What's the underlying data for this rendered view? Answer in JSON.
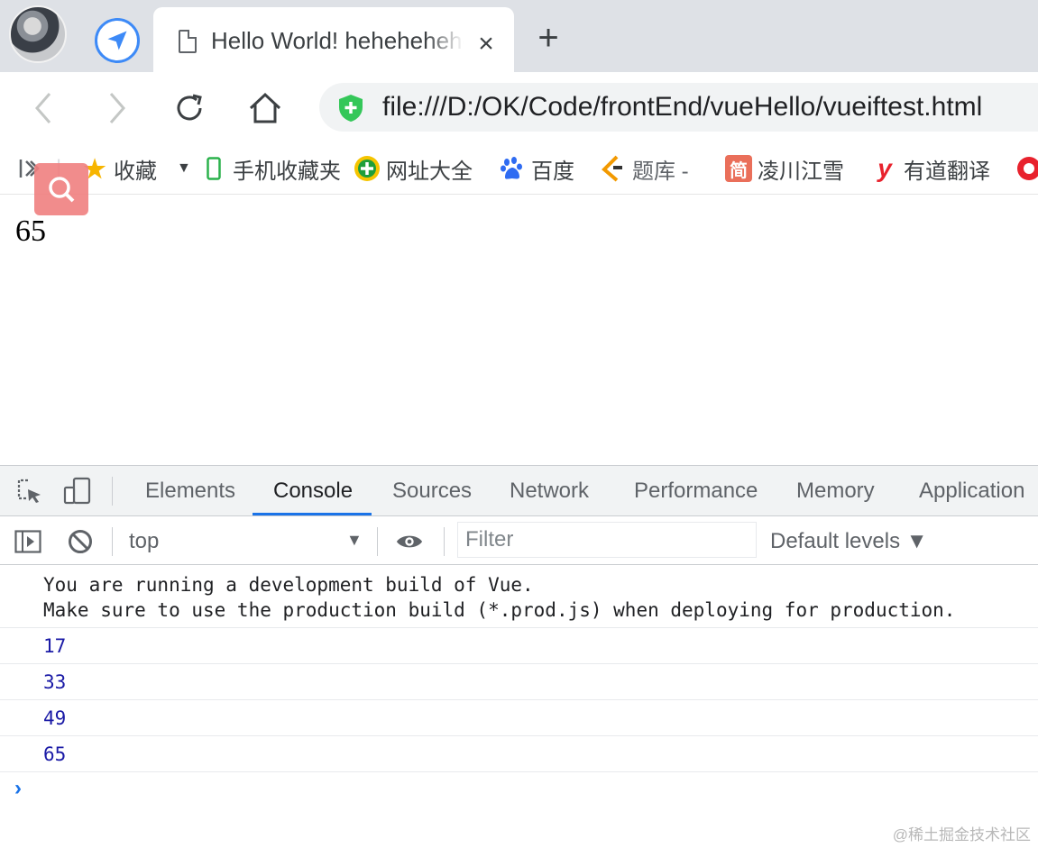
{
  "browser": {
    "tab": {
      "title": "Hello World! hehehehehe",
      "close_label": "×"
    },
    "new_tab_label": "+",
    "url": "file:///D:/OK/Code/frontEnd/vueHello/vueiftest.html",
    "bookmarks": [
      {
        "label": "收藏",
        "icon": "star-icon"
      },
      {
        "label": "手机收藏夹",
        "icon": "phone-icon"
      },
      {
        "label": "网址大全",
        "icon": "plus-circle-icon"
      },
      {
        "label": "百度",
        "icon": "baidu-paw-icon"
      },
      {
        "label": "题库 -",
        "icon": "tiku-icon"
      },
      {
        "label": "凌川江雪",
        "icon": "jian-icon"
      },
      {
        "label": "有道翻译",
        "icon": "youdao-y-icon"
      }
    ]
  },
  "page": {
    "value": "65"
  },
  "devtools": {
    "tabs": [
      "Elements",
      "Console",
      "Sources",
      "Network",
      "Performance",
      "Memory",
      "Application"
    ],
    "active_tab": "Console",
    "context": "top",
    "filter_placeholder": "Filter",
    "levels": "Default levels ▼",
    "messages": {
      "info_line1": "You are running a development build of Vue.",
      "info_line2": "Make sure to use the production build (*.prod.js) when deploying for production.",
      "values": [
        "17",
        "33",
        "49",
        "65"
      ]
    },
    "prompt": "›"
  },
  "watermark": "@稀土掘金技术社区",
  "colors": {
    "accent": "#1a73e8",
    "console_number": "#1a1aa6",
    "secure_shield": "#34c759"
  }
}
